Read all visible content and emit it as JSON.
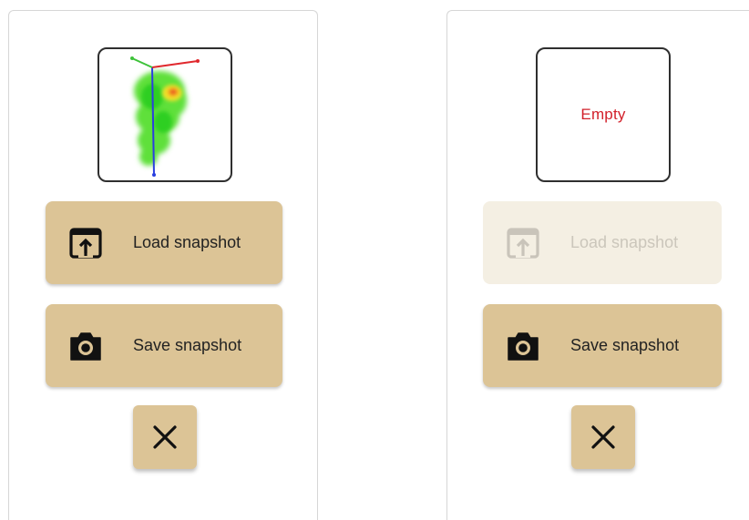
{
  "panels": [
    {
      "thumbnail": {
        "state": "snapshot-preview",
        "empty_text": ""
      },
      "load_button": {
        "label": "Load snapshot",
        "enabled": true,
        "icon": "upload-window-icon"
      },
      "save_button": {
        "label": "Save snapshot",
        "enabled": true,
        "icon": "camera-icon"
      },
      "close_button": {
        "icon": "close-icon"
      }
    },
    {
      "thumbnail": {
        "state": "empty",
        "empty_text": "Empty"
      },
      "load_button": {
        "label": "Load snapshot",
        "enabled": false,
        "icon": "upload-window-icon"
      },
      "save_button": {
        "label": "Save snapshot",
        "enabled": true,
        "icon": "camera-icon"
      },
      "close_button": {
        "icon": "close-icon"
      }
    }
  ],
  "colors": {
    "button_bg": "#dcc496",
    "button_disabled_bg": "#f4efe3",
    "empty_text": "#d2202a",
    "thumbnail_border": "#2f2f2f"
  }
}
